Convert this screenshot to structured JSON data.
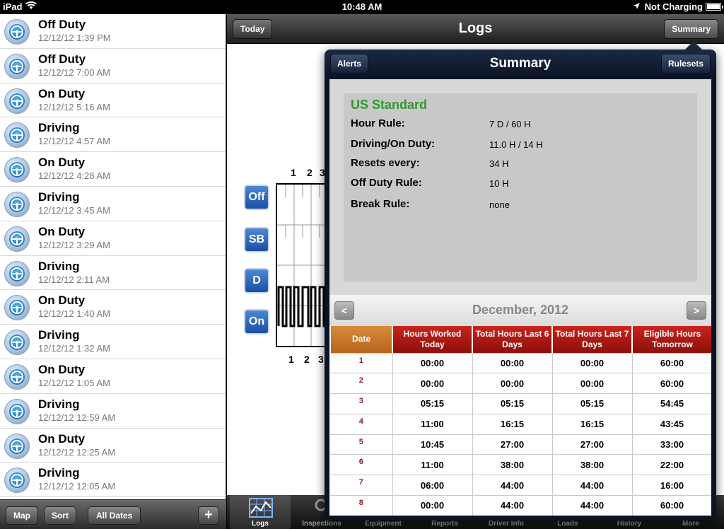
{
  "status_bar": {
    "device": "iPad",
    "time": "10:48 AM",
    "charging": "Not Charging"
  },
  "log_entries": [
    {
      "status": "Off Duty",
      "timestamp": "12/12/12 1:39 PM"
    },
    {
      "status": "Off Duty",
      "timestamp": "12/12/12 7:00 AM"
    },
    {
      "status": "On Duty",
      "timestamp": "12/12/12 5:16 AM"
    },
    {
      "status": "Driving",
      "timestamp": "12/12/12 4:57 AM"
    },
    {
      "status": "On Duty",
      "timestamp": "12/12/12 4:28 AM"
    },
    {
      "status": "Driving",
      "timestamp": "12/12/12 3:45 AM"
    },
    {
      "status": "On Duty",
      "timestamp": "12/12/12 3:29 AM"
    },
    {
      "status": "Driving",
      "timestamp": "12/12/12 2:11 AM"
    },
    {
      "status": "On Duty",
      "timestamp": "12/12/12 1:40 AM"
    },
    {
      "status": "Driving",
      "timestamp": "12/12/12 1:32 AM"
    },
    {
      "status": "On Duty",
      "timestamp": "12/12/12 1:05 AM"
    },
    {
      "status": "Driving",
      "timestamp": "12/12/12 12:59 AM"
    },
    {
      "status": "On Duty",
      "timestamp": "12/12/12 12:25 AM"
    },
    {
      "status": "Driving",
      "timestamp": "12/12/12 12:05 AM"
    }
  ],
  "left_toolbar": {
    "map": "Map",
    "sort": "Sort",
    "all_dates": "All Dates",
    "add": "+"
  },
  "navbar": {
    "title": "Logs",
    "today": "Today",
    "summary": "Summary"
  },
  "log_graph": {
    "hour_labels": [
      "1",
      "2",
      "3"
    ],
    "status_buttons": [
      "Off",
      "SB",
      "D",
      "On"
    ]
  },
  "popover": {
    "title": "Summary",
    "alerts": "Alerts",
    "rulesets": "Rulesets",
    "ruleset_name": "US Standard",
    "rules": [
      {
        "label": "Hour Rule:",
        "value": "7 D / 60 H"
      },
      {
        "label": "Driving/On Duty:",
        "value": "11.0 H / 14 H"
      },
      {
        "label": "Resets every:",
        "value": "34 H"
      },
      {
        "label": "Off Duty Rule:",
        "value": "10 H"
      },
      {
        "label": "Break Rule:",
        "value": "none"
      }
    ],
    "month": "December, 2012",
    "prev": "<",
    "next": ">",
    "table_headers": [
      "Date",
      "Hours Worked Today",
      "Total Hours Last 6 Days",
      "Total Hours Last 7 Days",
      "Eligible Hours Tomorrow"
    ],
    "table_rows": [
      [
        "1",
        "00:00",
        "00:00",
        "00:00",
        "60:00"
      ],
      [
        "2",
        "00:00",
        "00:00",
        "00:00",
        "60:00"
      ],
      [
        "3",
        "05:15",
        "05:15",
        "05:15",
        "54:45"
      ],
      [
        "4",
        "11:00",
        "16:15",
        "16:15",
        "43:45"
      ],
      [
        "5",
        "10:45",
        "27:00",
        "27:00",
        "33:00"
      ],
      [
        "6",
        "11:00",
        "38:00",
        "38:00",
        "22:00"
      ],
      [
        "7",
        "06:00",
        "44:00",
        "44:00",
        "16:00"
      ],
      [
        "8",
        "00:00",
        "44:00",
        "44:00",
        "60:00"
      ]
    ]
  },
  "tabbar": {
    "tabs": [
      "Logs",
      "Inspections",
      "Equipment",
      "Reports",
      "Driver Info",
      "Loads",
      "History",
      "More"
    ]
  },
  "colors": {
    "ruleset_green": "#2e9a2e",
    "header_red": "#b01a14",
    "date_header_orange": "#c8782c",
    "status_button_blue": "#2a63bf"
  }
}
